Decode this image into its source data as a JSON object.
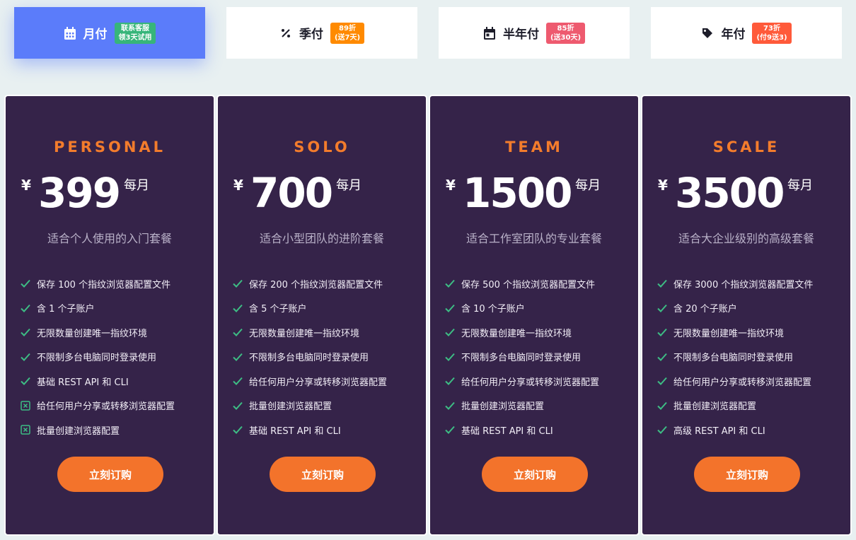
{
  "colors": {
    "accent_blue": "#5b7cfa",
    "card_bg": "#352349",
    "orange": "#f37c2c",
    "check_green": "#3dbd84",
    "badge_green": "#37b57a",
    "badge_orange": "#ff8a00",
    "badge_red": "#ee5a6f",
    "badge_coral": "#ff5a3a"
  },
  "tabs": [
    {
      "label": "月付",
      "icon": "calendar-grid-icon",
      "badge": "联系客服\n领3天试用",
      "badge_color": "#37b57a",
      "active": true
    },
    {
      "label": "季付",
      "icon": "percent-icon",
      "badge": "89折\n(送7天)",
      "badge_color": "#ff8a00",
      "active": false
    },
    {
      "label": "半年付",
      "icon": "calendar-icon",
      "badge": "85折\n(送30天)",
      "badge_color": "#ee5a6f",
      "active": false
    },
    {
      "label": "年付",
      "icon": "tag-icon",
      "badge": "73折\n(付9送3)",
      "badge_color": "#ff5a3a",
      "active": false
    }
  ],
  "plans": [
    {
      "name": "PERSONAL",
      "currency": "¥",
      "price": "399",
      "period": "每月",
      "desc": "适合个人使用的入门套餐",
      "features": [
        {
          "text": "保存 100 个指纹浏览器配置文件",
          "included": true
        },
        {
          "text": "含 1 个子账户",
          "included": true
        },
        {
          "text": "无限数量创建唯一指纹环境",
          "included": true
        },
        {
          "text": "不限制多台电脑同时登录使用",
          "included": true
        },
        {
          "text": "基础 REST API 和 CLI",
          "included": true
        },
        {
          "text": "给任何用户分享或转移浏览器配置",
          "included": false
        },
        {
          "text": "批量创建浏览器配置",
          "included": false
        }
      ],
      "cta": "立刻订购"
    },
    {
      "name": "SOLO",
      "currency": "¥",
      "price": "700",
      "period": "每月",
      "desc": "适合小型团队的进阶套餐",
      "features": [
        {
          "text": "保存 200 个指纹浏览器配置文件",
          "included": true
        },
        {
          "text": "含 5 个子账户",
          "included": true
        },
        {
          "text": "无限数量创建唯一指纹环境",
          "included": true
        },
        {
          "text": "不限制多台电脑同时登录使用",
          "included": true
        },
        {
          "text": "给任何用户分享或转移浏览器配置",
          "included": true
        },
        {
          "text": "批量创建浏览器配置",
          "included": true
        },
        {
          "text": "基础 REST API 和 CLI",
          "included": true
        }
      ],
      "cta": "立刻订购"
    },
    {
      "name": "TEAM",
      "currency": "¥",
      "price": "1500",
      "period": "每月",
      "desc": "适合工作室团队的专业套餐",
      "features": [
        {
          "text": "保存 500 个指纹浏览器配置文件",
          "included": true
        },
        {
          "text": "含 10 个子账户",
          "included": true
        },
        {
          "text": "无限数量创建唯一指纹环境",
          "included": true
        },
        {
          "text": "不限制多台电脑同时登录使用",
          "included": true
        },
        {
          "text": "给任何用户分享或转移浏览器配置",
          "included": true
        },
        {
          "text": "批量创建浏览器配置",
          "included": true
        },
        {
          "text": "基础 REST API 和 CLI",
          "included": true
        }
      ],
      "cta": "立刻订购"
    },
    {
      "name": "SCALE",
      "currency": "¥",
      "price": "3500",
      "period": "每月",
      "desc": "适合大企业级别的高级套餐",
      "features": [
        {
          "text": "保存 3000 个指纹浏览器配置文件",
          "included": true
        },
        {
          "text": "含 20 个子账户",
          "included": true
        },
        {
          "text": "无限数量创建唯一指纹环境",
          "included": true
        },
        {
          "text": "不限制多台电脑同时登录使用",
          "included": true
        },
        {
          "text": "给任何用户分享或转移浏览器配置",
          "included": true
        },
        {
          "text": "批量创建浏览器配置",
          "included": true
        },
        {
          "text": "高级 REST API 和 CLI",
          "included": true
        }
      ],
      "cta": "立刻订购"
    }
  ]
}
